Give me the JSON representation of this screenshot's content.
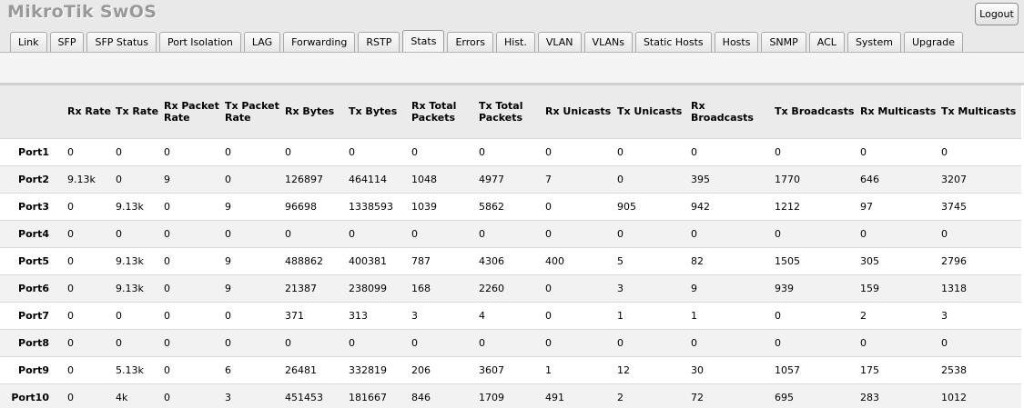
{
  "app": {
    "title": "MikroTik SwOS",
    "logout_label": "Logout"
  },
  "tabs": [
    {
      "label": "Link"
    },
    {
      "label": "SFP"
    },
    {
      "label": "SFP Status"
    },
    {
      "label": "Port Isolation"
    },
    {
      "label": "LAG"
    },
    {
      "label": "Forwarding"
    },
    {
      "label": "RSTP"
    },
    {
      "label": "Stats"
    },
    {
      "label": "Errors"
    },
    {
      "label": "Hist."
    },
    {
      "label": "VLAN"
    },
    {
      "label": "VLANs"
    },
    {
      "label": "Static Hosts"
    },
    {
      "label": "Hosts"
    },
    {
      "label": "SNMP"
    },
    {
      "label": "ACL"
    },
    {
      "label": "System"
    },
    {
      "label": "Upgrade"
    }
  ],
  "active_tab": "Stats",
  "stats": {
    "columns": [
      "",
      "Rx Rate",
      "Tx Rate",
      "Rx Packet Rate",
      "Tx Packet Rate",
      "Rx Bytes",
      "Tx Bytes",
      "Rx Total Packets",
      "Tx Total Packets",
      "Rx Unicasts",
      "Tx Unicasts",
      "Rx Broadcasts",
      "Tx Broadcasts",
      "Rx Multicasts",
      "Tx Multicasts"
    ],
    "rows": [
      [
        "Port1",
        "0",
        "0",
        "0",
        "0",
        "0",
        "0",
        "0",
        "0",
        "0",
        "0",
        "0",
        "0",
        "0",
        "0"
      ],
      [
        "Port2",
        "9.13k",
        "0",
        "9",
        "0",
        "126897",
        "464114",
        "1048",
        "4977",
        "7",
        "0",
        "395",
        "1770",
        "646",
        "3207"
      ],
      [
        "Port3",
        "0",
        "9.13k",
        "0",
        "9",
        "96698",
        "1338593",
        "1039",
        "5862",
        "0",
        "905",
        "942",
        "1212",
        "97",
        "3745"
      ],
      [
        "Port4",
        "0",
        "0",
        "0",
        "0",
        "0",
        "0",
        "0",
        "0",
        "0",
        "0",
        "0",
        "0",
        "0",
        "0"
      ],
      [
        "Port5",
        "0",
        "9.13k",
        "0",
        "9",
        "488862",
        "400381",
        "787",
        "4306",
        "400",
        "5",
        "82",
        "1505",
        "305",
        "2796"
      ],
      [
        "Port6",
        "0",
        "9.13k",
        "0",
        "9",
        "21387",
        "238099",
        "168",
        "2260",
        "0",
        "3",
        "9",
        "939",
        "159",
        "1318"
      ],
      [
        "Port7",
        "0",
        "0",
        "0",
        "0",
        "371",
        "313",
        "3",
        "4",
        "0",
        "1",
        "1",
        "0",
        "2",
        "3"
      ],
      [
        "Port8",
        "0",
        "0",
        "0",
        "0",
        "0",
        "0",
        "0",
        "0",
        "0",
        "0",
        "0",
        "0",
        "0",
        "0"
      ],
      [
        "Port9",
        "0",
        "5.13k",
        "0",
        "6",
        "26481",
        "332819",
        "206",
        "3607",
        "1",
        "12",
        "30",
        "1057",
        "175",
        "2538"
      ],
      [
        "Port10",
        "0",
        "4k",
        "0",
        "3",
        "451453",
        "181667",
        "846",
        "1709",
        "491",
        "2",
        "72",
        "695",
        "283",
        "1012"
      ]
    ]
  }
}
